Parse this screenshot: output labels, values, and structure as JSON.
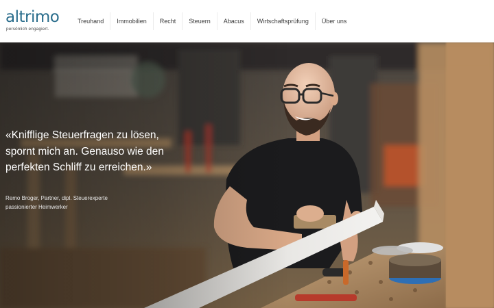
{
  "brand": {
    "name": "altrimo",
    "tagline": "persönlich engagiert."
  },
  "nav": {
    "items": [
      "Treuhand",
      "Immobilien",
      "Recht",
      "Steuern",
      "Abacus",
      "Wirtschaftsprüfung",
      "Über uns"
    ]
  },
  "hero": {
    "quote": "«Knifflige Steuerfragen zu lösen, spornt mich an. Genauso wie den perfekten Schliff zu erreichen.»",
    "author_line1": "Remo Broger, Partner, dipl. Steuerexperte",
    "author_line2": "passionierter Heimwerker"
  },
  "colors": {
    "brand": "#2a6d8c",
    "nav_text": "#3a3a3a",
    "hero_text": "#ffffff"
  }
}
